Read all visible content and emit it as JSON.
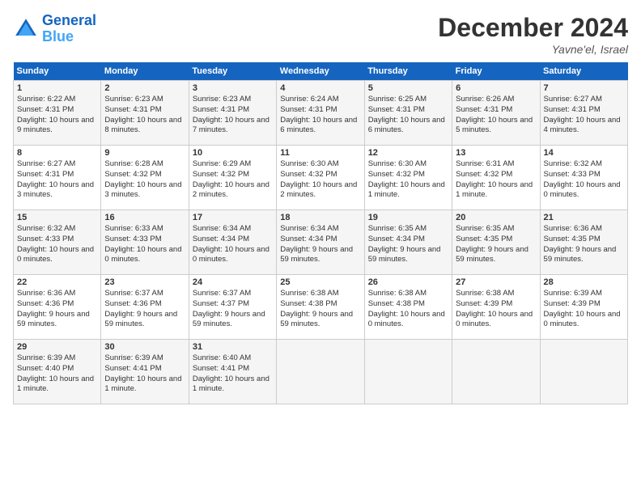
{
  "header": {
    "logo_line1": "General",
    "logo_line2": "Blue",
    "month_year": "December 2024",
    "location": "Yavne'el, Israel"
  },
  "weekdays": [
    "Sunday",
    "Monday",
    "Tuesday",
    "Wednesday",
    "Thursday",
    "Friday",
    "Saturday"
  ],
  "weeks": [
    [
      {
        "day": "1",
        "sunrise": "6:22 AM",
        "sunset": "4:31 PM",
        "daylight": "10 hours and 9 minutes."
      },
      {
        "day": "2",
        "sunrise": "6:23 AM",
        "sunset": "4:31 PM",
        "daylight": "10 hours and 8 minutes."
      },
      {
        "day": "3",
        "sunrise": "6:23 AM",
        "sunset": "4:31 PM",
        "daylight": "10 hours and 7 minutes."
      },
      {
        "day": "4",
        "sunrise": "6:24 AM",
        "sunset": "4:31 PM",
        "daylight": "10 hours and 6 minutes."
      },
      {
        "day": "5",
        "sunrise": "6:25 AM",
        "sunset": "4:31 PM",
        "daylight": "10 hours and 6 minutes."
      },
      {
        "day": "6",
        "sunrise": "6:26 AM",
        "sunset": "4:31 PM",
        "daylight": "10 hours and 5 minutes."
      },
      {
        "day": "7",
        "sunrise": "6:27 AM",
        "sunset": "4:31 PM",
        "daylight": "10 hours and 4 minutes."
      }
    ],
    [
      {
        "day": "8",
        "sunrise": "6:27 AM",
        "sunset": "4:31 PM",
        "daylight": "10 hours and 3 minutes."
      },
      {
        "day": "9",
        "sunrise": "6:28 AM",
        "sunset": "4:32 PM",
        "daylight": "10 hours and 3 minutes."
      },
      {
        "day": "10",
        "sunrise": "6:29 AM",
        "sunset": "4:32 PM",
        "daylight": "10 hours and 2 minutes."
      },
      {
        "day": "11",
        "sunrise": "6:30 AM",
        "sunset": "4:32 PM",
        "daylight": "10 hours and 2 minutes."
      },
      {
        "day": "12",
        "sunrise": "6:30 AM",
        "sunset": "4:32 PM",
        "daylight": "10 hours and 1 minute."
      },
      {
        "day": "13",
        "sunrise": "6:31 AM",
        "sunset": "4:32 PM",
        "daylight": "10 hours and 1 minute."
      },
      {
        "day": "14",
        "sunrise": "6:32 AM",
        "sunset": "4:33 PM",
        "daylight": "10 hours and 0 minutes."
      }
    ],
    [
      {
        "day": "15",
        "sunrise": "6:32 AM",
        "sunset": "4:33 PM",
        "daylight": "10 hours and 0 minutes."
      },
      {
        "day": "16",
        "sunrise": "6:33 AM",
        "sunset": "4:33 PM",
        "daylight": "10 hours and 0 minutes."
      },
      {
        "day": "17",
        "sunrise": "6:34 AM",
        "sunset": "4:34 PM",
        "daylight": "10 hours and 0 minutes."
      },
      {
        "day": "18",
        "sunrise": "6:34 AM",
        "sunset": "4:34 PM",
        "daylight": "9 hours and 59 minutes."
      },
      {
        "day": "19",
        "sunrise": "6:35 AM",
        "sunset": "4:34 PM",
        "daylight": "9 hours and 59 minutes."
      },
      {
        "day": "20",
        "sunrise": "6:35 AM",
        "sunset": "4:35 PM",
        "daylight": "9 hours and 59 minutes."
      },
      {
        "day": "21",
        "sunrise": "6:36 AM",
        "sunset": "4:35 PM",
        "daylight": "9 hours and 59 minutes."
      }
    ],
    [
      {
        "day": "22",
        "sunrise": "6:36 AM",
        "sunset": "4:36 PM",
        "daylight": "9 hours and 59 minutes."
      },
      {
        "day": "23",
        "sunrise": "6:37 AM",
        "sunset": "4:36 PM",
        "daylight": "9 hours and 59 minutes."
      },
      {
        "day": "24",
        "sunrise": "6:37 AM",
        "sunset": "4:37 PM",
        "daylight": "9 hours and 59 minutes."
      },
      {
        "day": "25",
        "sunrise": "6:38 AM",
        "sunset": "4:38 PM",
        "daylight": "9 hours and 59 minutes."
      },
      {
        "day": "26",
        "sunrise": "6:38 AM",
        "sunset": "4:38 PM",
        "daylight": "10 hours and 0 minutes."
      },
      {
        "day": "27",
        "sunrise": "6:38 AM",
        "sunset": "4:39 PM",
        "daylight": "10 hours and 0 minutes."
      },
      {
        "day": "28",
        "sunrise": "6:39 AM",
        "sunset": "4:39 PM",
        "daylight": "10 hours and 0 minutes."
      }
    ],
    [
      {
        "day": "29",
        "sunrise": "6:39 AM",
        "sunset": "4:40 PM",
        "daylight": "10 hours and 1 minute."
      },
      {
        "day": "30",
        "sunrise": "6:39 AM",
        "sunset": "4:41 PM",
        "daylight": "10 hours and 1 minute."
      },
      {
        "day": "31",
        "sunrise": "6:40 AM",
        "sunset": "4:41 PM",
        "daylight": "10 hours and 1 minute."
      },
      null,
      null,
      null,
      null
    ]
  ]
}
